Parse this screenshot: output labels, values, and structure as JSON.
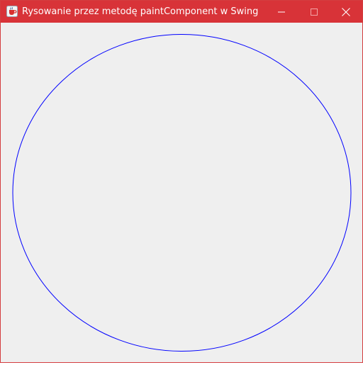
{
  "window": {
    "title": "Rysowanie przez metodę paintComponent w Swing",
    "icon": "java-coffee-cup-icon",
    "controls": {
      "minimize": "minimize-icon",
      "maximize": "maximize-icon",
      "close": "close-icon"
    },
    "colors": {
      "titlebar": "#d83338",
      "border": "#d43d3f",
      "content_background": "#efefef"
    }
  },
  "canvas": {
    "shape": "ellipse",
    "stroke_color": "#0000ff",
    "fill": "none"
  }
}
